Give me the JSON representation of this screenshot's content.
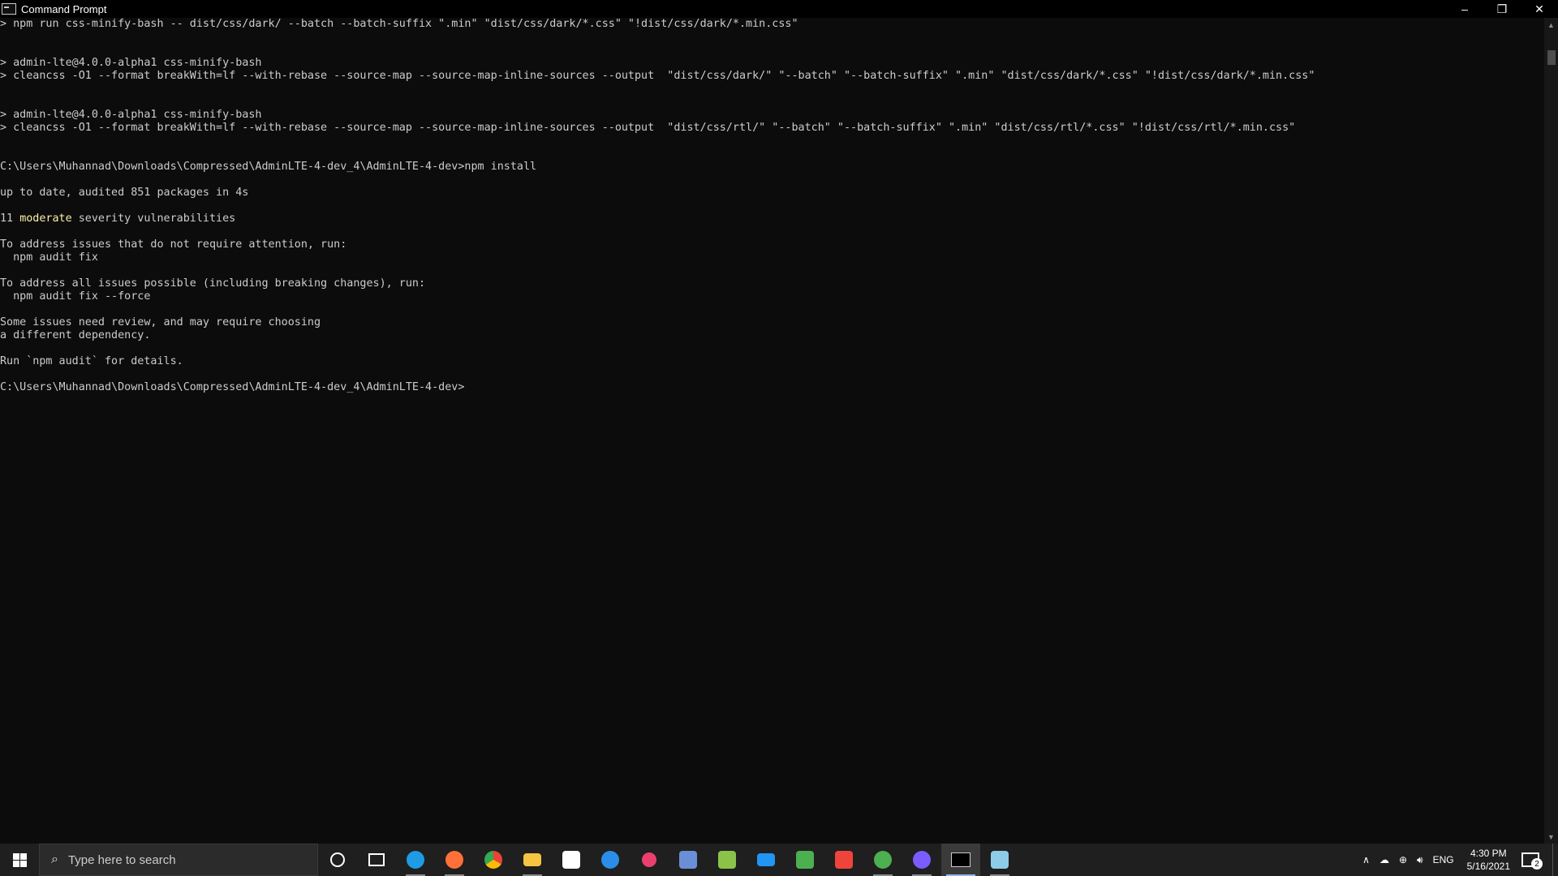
{
  "window": {
    "title": "Command Prompt",
    "minimize_glyph": "–",
    "restore_glyph": "❐",
    "close_glyph": "✕"
  },
  "console": {
    "lines": [
      "> npm run css-minify-bash -- dist/css/dark/ --batch --batch-suffix \".min\" \"dist/css/dark/*.css\" \"!dist/css/dark/*.min.css\"",
      "",
      "",
      "> admin-lte@4.0.0-alpha1 css-minify-bash",
      "> cleancss -O1 --format breakWith=lf --with-rebase --source-map --source-map-inline-sources --output  \"dist/css/dark/\" \"--batch\" \"--batch-suffix\" \".min\" \"dist/css/dark/*.css\" \"!dist/css/dark/*.min.css\"",
      "",
      "",
      "> admin-lte@4.0.0-alpha1 css-minify-bash",
      "> cleancss -O1 --format breakWith=lf --with-rebase --source-map --source-map-inline-sources --output  \"dist/css/rtl/\" \"--batch\" \"--batch-suffix\" \".min\" \"dist/css/rtl/*.css\" \"!dist/css/rtl/*.min.css\"",
      "",
      "",
      "C:\\Users\\Muhannad\\Downloads\\Compressed\\AdminLTE-4-dev_4\\AdminLTE-4-dev>npm install",
      "",
      "up to date, audited 851 packages in 4s",
      ""
    ],
    "vuln_count": "11",
    "vuln_severity": "moderate",
    "vuln_rest": " severity vulnerabilities",
    "lines_after": [
      "",
      "To address issues that do not require attention, run:",
      "  npm audit fix",
      "",
      "To address all issues possible (including breaking changes), run:",
      "  npm audit fix --force",
      "",
      "Some issues need review, and may require choosing",
      "a different dependency.",
      "",
      "Run `npm audit` for details.",
      "",
      "C:\\Users\\Muhannad\\Downloads\\Compressed\\AdminLTE-4-dev_4\\AdminLTE-4-dev>"
    ]
  },
  "taskbar": {
    "search_placeholder": "Type here to search",
    "apps": [
      {
        "name": "cortana-icon",
        "color": "#ffffff"
      },
      {
        "name": "task-view-icon",
        "color": "#ffffff"
      },
      {
        "name": "edge-icon",
        "color": "#1f9be3"
      },
      {
        "name": "firefox-icon",
        "color": "#ff7139"
      },
      {
        "name": "chrome-icon",
        "color": "#4caf50"
      },
      {
        "name": "file-explorer-icon",
        "color": "#f5c542"
      },
      {
        "name": "store-icon",
        "color": "#3a86d8"
      },
      {
        "name": "skype-icon",
        "color": "#2a8ee8"
      },
      {
        "name": "instagram-icon",
        "color": "#e94070"
      },
      {
        "name": "network-tool-icon",
        "color": "#6b8fd6"
      },
      {
        "name": "sync-app-icon",
        "color": "#8bc34a"
      },
      {
        "name": "mail-icon",
        "color": "#2196f3"
      },
      {
        "name": "store-app-icon",
        "color": "#4caf50"
      },
      {
        "name": "anydesk-icon",
        "color": "#ef443b"
      },
      {
        "name": "utorrent-icon",
        "color": "#4caf50"
      },
      {
        "name": "messenger-icon",
        "color": "#7b5cff"
      },
      {
        "name": "cmd-icon",
        "color": "#cccccc"
      },
      {
        "name": "notepad-icon",
        "color": "#8ecbe8"
      }
    ],
    "tray": {
      "language": "ENG",
      "time": "4:30 PM",
      "date": "5/16/2021",
      "notification_count": "2"
    }
  }
}
